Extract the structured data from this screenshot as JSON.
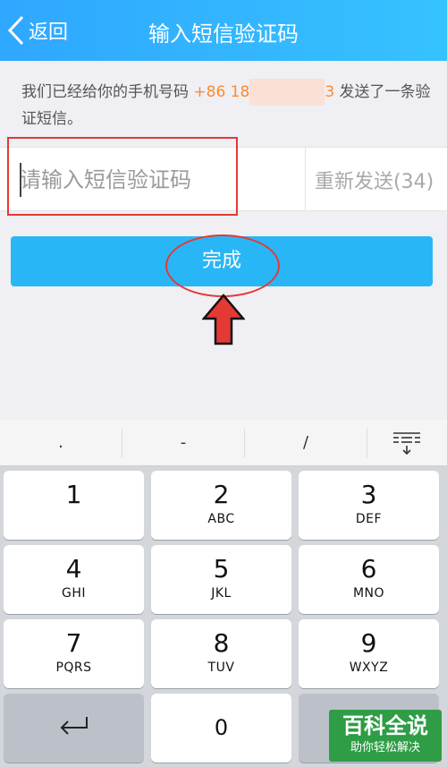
{
  "header": {
    "back_label": "返回",
    "title": "输入短信验证码"
  },
  "info": {
    "prefix": "我们已经给你的手机号码 ",
    "phone_start": "+86 18",
    "phone_end": "3",
    "suffix": " 发送了一条验证短信。"
  },
  "input": {
    "placeholder": "请输入短信验证码",
    "value": ""
  },
  "resend_label": "重新发送(34)",
  "done_label": "完成",
  "keyboard": {
    "suggestions": [
      ".",
      "-",
      "/"
    ],
    "keys": [
      {
        "num": "1",
        "sub": ""
      },
      {
        "num": "2",
        "sub": "ABC"
      },
      {
        "num": "3",
        "sub": "DEF"
      },
      {
        "num": "4",
        "sub": "GHI"
      },
      {
        "num": "5",
        "sub": "JKL"
      },
      {
        "num": "6",
        "sub": "MNO"
      },
      {
        "num": "7",
        "sub": "PQRS"
      },
      {
        "num": "8",
        "sub": "TUV"
      },
      {
        "num": "9",
        "sub": "WXYZ"
      }
    ],
    "zero": "0"
  },
  "watermark": {
    "main": "百科全说",
    "sub": "助你轻松解决"
  },
  "colors": {
    "header": "#2fa7ff",
    "button": "#29b6f6",
    "phone": "#ff8a2e",
    "annotation": "#e53935"
  },
  "icons": [
    "chevron-left-icon",
    "enter-icon",
    "keyboard-hide-icon",
    "up-arrow-icon"
  ]
}
